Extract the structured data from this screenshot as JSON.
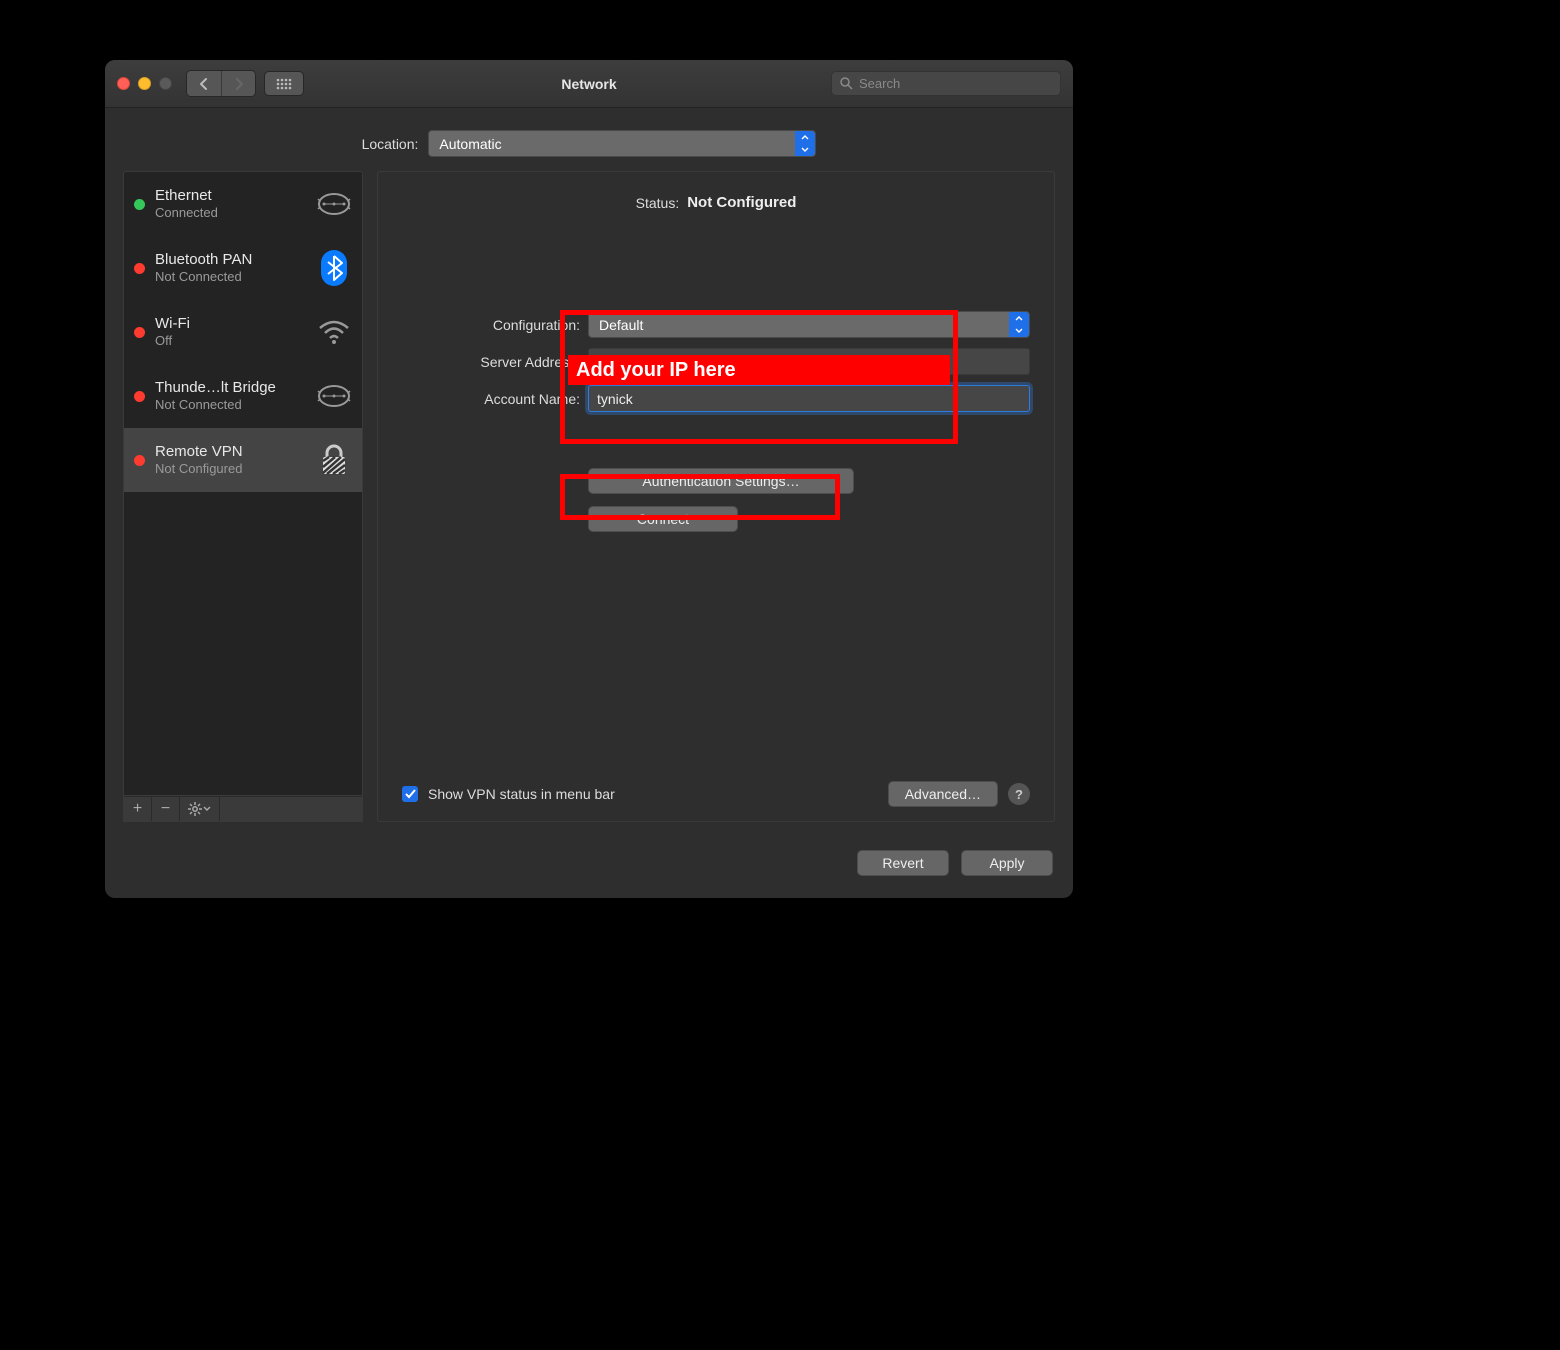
{
  "window": {
    "title": "Network"
  },
  "search": {
    "placeholder": "Search"
  },
  "location": {
    "label": "Location:",
    "value": "Automatic"
  },
  "sidebar": {
    "items": [
      {
        "name": "Ethernet",
        "status": "Connected",
        "dot": "green",
        "icon": "ethernet"
      },
      {
        "name": "Bluetooth PAN",
        "status": "Not Connected",
        "dot": "red",
        "icon": "bluetooth"
      },
      {
        "name": "Wi-Fi",
        "status": "Off",
        "dot": "red",
        "icon": "wifi"
      },
      {
        "name": "Thunde…lt Bridge",
        "status": "Not Connected",
        "dot": "red",
        "icon": "ethernet"
      },
      {
        "name": "Remote VPN",
        "status": "Not Configured",
        "dot": "red",
        "icon": "lock"
      }
    ]
  },
  "status": {
    "label": "Status:",
    "value": "Not Configured"
  },
  "form": {
    "configuration": {
      "label": "Configuration:",
      "value": "Default"
    },
    "server": {
      "label": "Server Address:"
    },
    "account": {
      "label": "Account Name:",
      "value": "tynick"
    },
    "auth_button": "Authentication Settings…",
    "connect_button": "Connect"
  },
  "checkbox": {
    "label": "Show VPN status in menu bar",
    "checked": true
  },
  "advanced_button": "Advanced…",
  "footer": {
    "revert": "Revert",
    "apply": "Apply"
  },
  "annotation": {
    "ip_text": "Add your IP here"
  }
}
